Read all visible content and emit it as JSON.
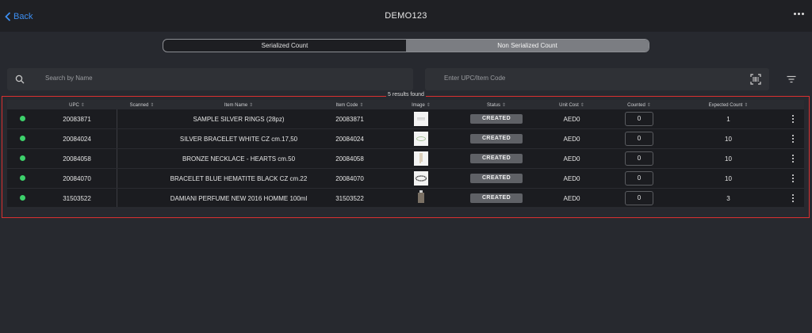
{
  "header": {
    "back_label": "Back",
    "title": "DEMO123"
  },
  "segment": {
    "tabs": [
      {
        "label": "Serialized Count",
        "active": false
      },
      {
        "label": "Non Serialized Count",
        "active": true
      }
    ]
  },
  "search": {
    "placeholder": "Search by Name"
  },
  "upc_search": {
    "placeholder": "Enter UPC/Item Code"
  },
  "results": {
    "label": "5 results found"
  },
  "table": {
    "columns": [
      "UPC",
      "Scanned",
      "Item Name",
      "Item Code",
      "Image",
      "Status",
      "Unit Cost",
      "Counted",
      "Expected Count"
    ],
    "rows": [
      {
        "upc": "20083871",
        "scanned": "",
        "name": "SAMPLE SILVER RINGS (28pz)",
        "code": "20083871",
        "image": "rings-thumbnail",
        "status": "CREATED",
        "cost": "AED0",
        "counted": "0",
        "expected": "1"
      },
      {
        "upc": "20084024",
        "scanned": "",
        "name": "SILVER BRACELET WHITE CZ cm.17,50",
        "code": "20084024",
        "image": "bracelet-thumbnail",
        "status": "CREATED",
        "cost": "AED0",
        "counted": "0",
        "expected": "10"
      },
      {
        "upc": "20084058",
        "scanned": "",
        "name": "BRONZE NECKLACE - HEARTS cm.50",
        "code": "20084058",
        "image": "necklace-thumbnail",
        "status": "CREATED",
        "cost": "AED0",
        "counted": "0",
        "expected": "10"
      },
      {
        "upc": "20084070",
        "scanned": "",
        "name": "BRACELET BLUE HEMATITE BLACK CZ cm.22",
        "code": "20084070",
        "image": "hematite-bracelet-thumbnail",
        "status": "CREATED",
        "cost": "AED0",
        "counted": "0",
        "expected": "10"
      },
      {
        "upc": "31503522",
        "scanned": "",
        "name": "DAMIANI PERFUME NEW 2016 HOMME 100ml",
        "code": "31503522",
        "image": "perfume-thumbnail",
        "status": "CREATED",
        "cost": "AED0",
        "counted": "0",
        "expected": "3"
      }
    ]
  },
  "colors": {
    "accent": "#3d8ef0",
    "status_dot": "#3dd16b",
    "highlight_frame": "#d93030"
  }
}
